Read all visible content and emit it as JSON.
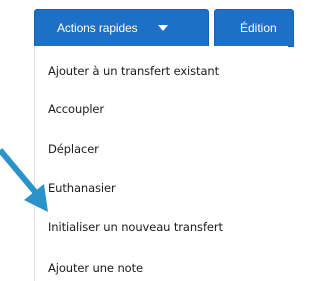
{
  "toolbar": {
    "actions_label": "Actions rapides",
    "edition_label": "Édition"
  },
  "menu": {
    "items": [
      {
        "label": "Ajouter à un transfert existant"
      },
      {
        "label": "Accoupler"
      },
      {
        "label": "Déplacer"
      },
      {
        "label": "Euthanasier"
      },
      {
        "label": "Initialiser un nouveau transfert"
      },
      {
        "label": "Ajouter une note"
      }
    ]
  },
  "colors": {
    "button_blue": "#1e6fc6",
    "arrow": "#2b93c9",
    "menu_text": "#1c1c1c"
  },
  "icons": {
    "dropdown": "caret-down-icon",
    "pointer": "arrow-pointer-icon"
  }
}
